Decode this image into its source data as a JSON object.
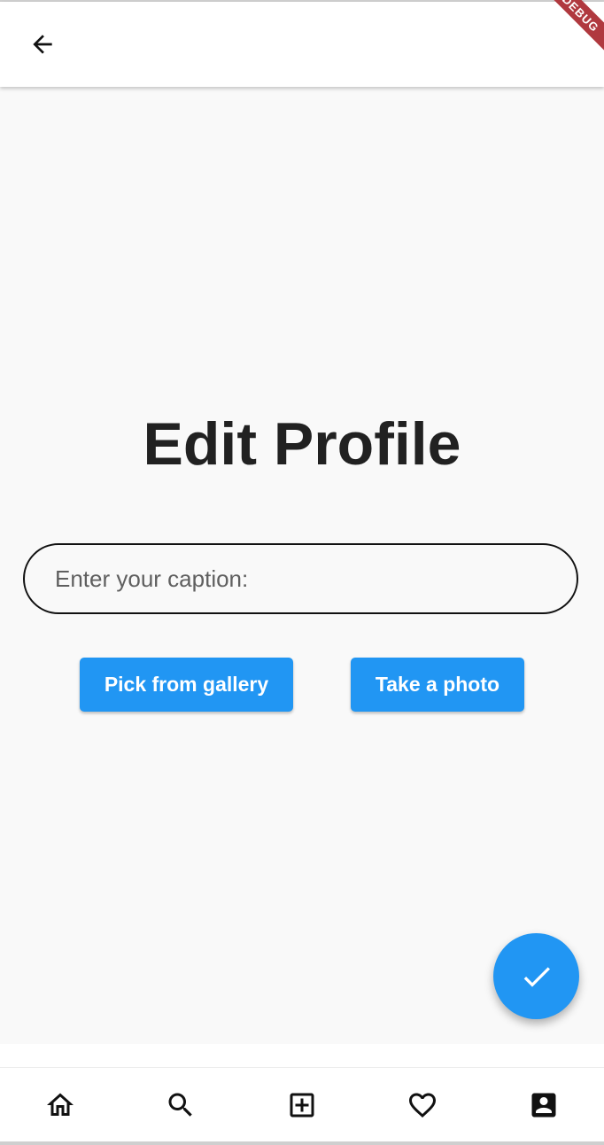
{
  "appbar": {
    "back_icon": "arrow-back-icon",
    "debug_banner": "DEBUG"
  },
  "page": {
    "title": "Edit Profile"
  },
  "caption": {
    "placeholder": "Enter your caption:",
    "value": ""
  },
  "buttons": {
    "gallery_label": "Pick from gallery",
    "photo_label": "Take a photo"
  },
  "fab": {
    "icon": "check-icon",
    "color": "#2196f3"
  },
  "bottom_nav": {
    "items": [
      {
        "icon": "home-icon"
      },
      {
        "icon": "search-icon"
      },
      {
        "icon": "add-box-icon"
      },
      {
        "icon": "heart-icon"
      },
      {
        "icon": "account-box-icon"
      }
    ]
  },
  "colors": {
    "accent": "#2196f3",
    "title": "#212121",
    "banner": "#b0393f"
  }
}
